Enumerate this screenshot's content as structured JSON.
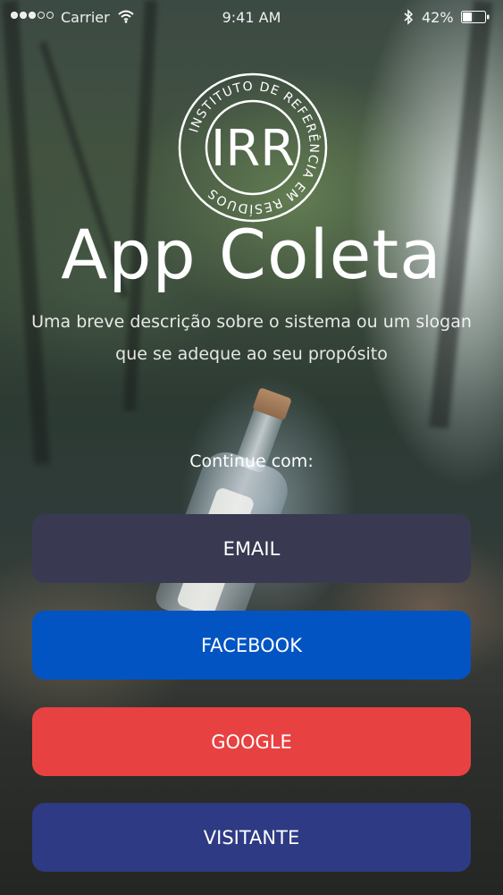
{
  "status_bar": {
    "carrier": "Carrier",
    "time": "9:41 AM",
    "battery": "42%",
    "battery_level": 0.42,
    "signal_bars_filled": 3,
    "signal_bars_total": 5,
    "icons": [
      "wifi-icon",
      "bluetooth-icon",
      "battery-icon"
    ]
  },
  "logo": {
    "initials": "IRR",
    "ring_text": "INSTITUTO DE REFERÊNCIA EM RESÍDUOS"
  },
  "header": {
    "title": "App Coleta",
    "tagline": "Uma breve descrição sobre o sistema ou um slogan que se adeque ao seu propósito"
  },
  "login": {
    "prompt": "Continue com:",
    "buttons": [
      {
        "label": "EMAIL",
        "color": "#393a51"
      },
      {
        "label": "FACEBOOK",
        "color": "#0254c3"
      },
      {
        "label": "GOOGLE",
        "color": "#e84141"
      },
      {
        "label": "VISITANTE",
        "color": "#2e3a83"
      }
    ]
  }
}
